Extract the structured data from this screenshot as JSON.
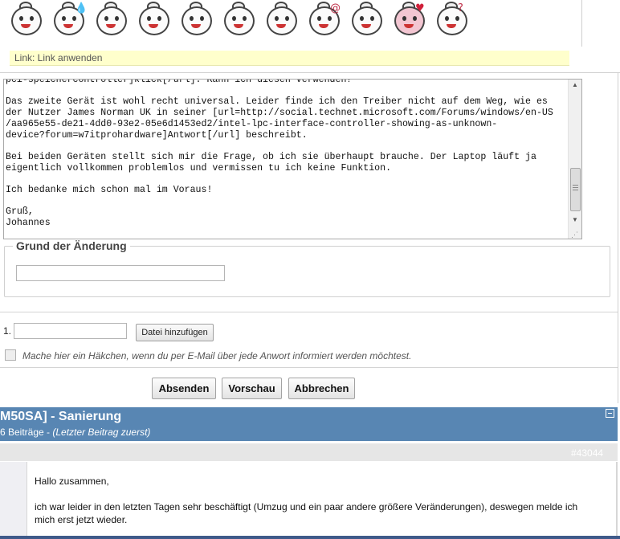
{
  "smileys": [
    {
      "icon": "relaxed-smiley-icon",
      "accent": "",
      "bg": "#fbfbfb"
    },
    {
      "icon": "sweating-smiley-icon",
      "accent": "💧",
      "bg": "#fbfbfb"
    },
    {
      "icon": "bandaged-smiley-icon",
      "accent": "",
      "bg": "#fbfbfb"
    },
    {
      "icon": "shouting-smiley-icon",
      "accent": "",
      "bg": "#fbfbfb"
    },
    {
      "icon": "crying-smiley-icon",
      "accent": "",
      "bg": "#fbfbfb"
    },
    {
      "icon": "screaming-smiley-icon",
      "accent": "",
      "bg": "#fbfbfb"
    },
    {
      "icon": "blushing-smiley-icon",
      "accent": "",
      "bg": "#fbfbfb"
    },
    {
      "icon": "dizzy-smiley-icon",
      "accent": "@",
      "bg": "#fbfbfb"
    },
    {
      "icon": "worried-smiley-icon",
      "accent": "",
      "bg": "#fbfbfb"
    },
    {
      "icon": "in-love-smiley-icon",
      "accent": "♥",
      "bg": "#f3c6d2"
    },
    {
      "icon": "confused-smiley-icon",
      "accent": "?",
      "bg": "#fbfbfb"
    }
  ],
  "link_bar": {
    "text": "Link: Link anwenden"
  },
  "editor": {
    "content": "pci-speichercontroller]klick[/url]. Kann ich diesen verwenden?\n\nDas zweite Gerät ist wohl recht universal. Leider finde ich den Treiber nicht auf dem Weg, wie es\nder Nutzer James Norman UK in seiner [url=http://social.technet.microsoft.com/Forums/windows/en-US\n/aa965e55-de21-4dd0-93e2-05e6d1453ed2/intel-lpc-interface-controller-showing-as-unknown-\ndevice?forum=w7itprohardware]Antwort[/url] beschreibt.\n\nBei beiden Geräten stellt sich mir die Frage, ob ich sie überhaupt brauche. Der Laptop läuft ja\neigentlich vollkommen problemlos und vermissen tu ich keine Funktion.\n\nIch bedanke mich schon mal im Voraus!\n\nGruß,\nJohannes"
  },
  "reason": {
    "legend": "Grund der Änderung",
    "value": ""
  },
  "attachment": {
    "number": "1.",
    "value": "",
    "button_label": "Datei hinzufügen"
  },
  "notify": {
    "label": "Mache hier ein Häkchen, wenn du per E-Mail über jede Anwort informiert werden möchtest.",
    "checked": false
  },
  "buttons": {
    "submit": "Absenden",
    "preview": "Vorschau",
    "cancel": "Abbrechen"
  },
  "topic": {
    "title": "M50SA] - Sanierung",
    "count": "6 Beiträge - ",
    "order": "(Letzter Beitrag zuerst)",
    "header_color": "#5886b3"
  },
  "post": {
    "id": "#43044",
    "greeting": "Hallo zusammen,",
    "text": "ich war leider in den letzten Tagen sehr beschäftigt (Umzug und ein paar andere größere Veränderungen), deswegen melde ich mich erst jetzt wieder."
  }
}
